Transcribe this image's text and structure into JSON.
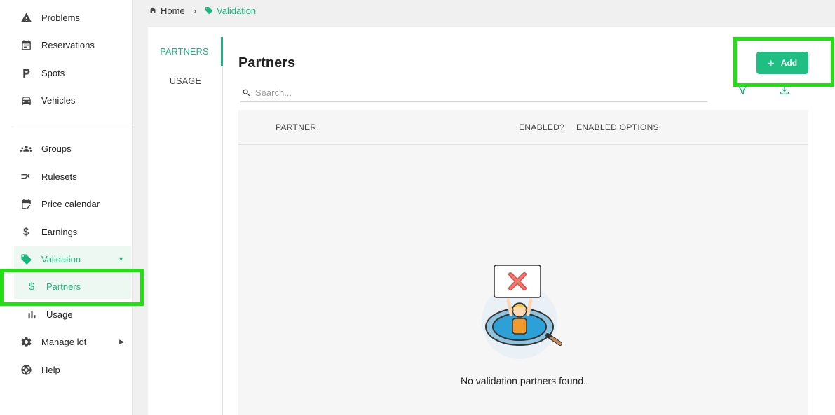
{
  "sidebar": {
    "items": [
      {
        "label": "Problems",
        "icon": "warning-icon"
      },
      {
        "label": "Reservations",
        "icon": "calendar-icon"
      },
      {
        "label": "Spots",
        "icon": "parking-icon"
      },
      {
        "label": "Vehicles",
        "icon": "car-icon"
      },
      {
        "label": "Groups",
        "icon": "groups-icon"
      },
      {
        "label": "Rulesets",
        "icon": "ruleset-icon"
      },
      {
        "label": "Price calendar",
        "icon": "calendar-edit-icon"
      },
      {
        "label": "Earnings",
        "icon": "dollar-icon"
      },
      {
        "label": "Validation",
        "icon": "tag-icon"
      },
      {
        "label": "Partners",
        "icon": "dollar-icon"
      },
      {
        "label": "Usage",
        "icon": "bar-chart-icon"
      },
      {
        "label": "Manage lot",
        "icon": "gear-icon"
      },
      {
        "label": "Help",
        "icon": "lifebuoy-icon"
      }
    ]
  },
  "breadcrumb": {
    "home": "Home",
    "current": "Validation"
  },
  "tabs": {
    "partners": "PARTNERS",
    "usage": "USAGE"
  },
  "main": {
    "title": "Partners",
    "search_placeholder": "Search...",
    "add_label": "Add",
    "columns": {
      "partner": "PARTNER",
      "enabled": "ENABLED?",
      "options": "ENABLED OPTIONS"
    },
    "empty_message": "No validation partners found."
  },
  "colors": {
    "accent": "#1fbf84",
    "highlight": "#22e012"
  }
}
